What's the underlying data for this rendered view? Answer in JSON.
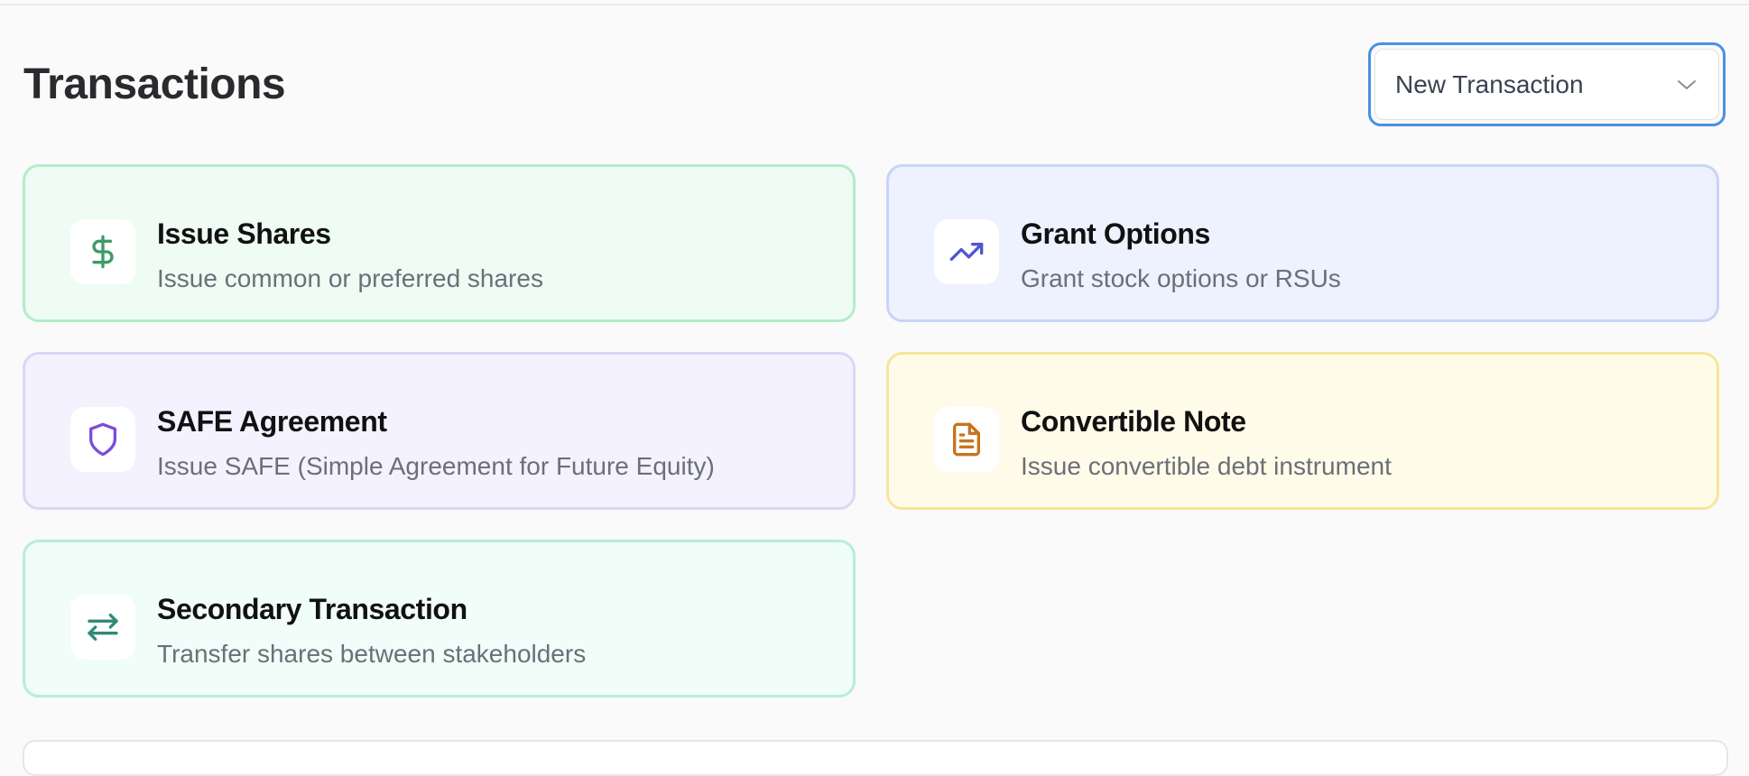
{
  "header": {
    "title": "Transactions",
    "select": {
      "value": "New Transaction"
    }
  },
  "cards": [
    {
      "title": "Issue Shares",
      "description": "Issue common or preferred shares",
      "icon": "dollar-icon",
      "color": "#3e9a68"
    },
    {
      "title": "Grant Options",
      "description": "Grant stock options or RSUs",
      "icon": "trending-up-icon",
      "color": "#4f55d4"
    },
    {
      "title": "SAFE Agreement",
      "description": "Issue SAFE (Simple Agreement for Future Equity)",
      "icon": "shield-icon",
      "color": "#7c4ddb"
    },
    {
      "title": "Convertible Note",
      "description": "Issue convertible debt instrument",
      "icon": "document-icon",
      "color": "#c7741f"
    },
    {
      "title": "Secondary Transaction",
      "description": "Transfer shares between stakeholders",
      "icon": "arrows-exchange-icon",
      "color": "#2e8b78"
    }
  ],
  "colors": {
    "accent": "#4a90e2",
    "green_bg": "#eefcf4",
    "blue_bg": "#eef1fe",
    "purple_bg": "#f4f2fe",
    "yellow_bg": "#fefce9",
    "teal_bg": "#f0fdf8"
  }
}
